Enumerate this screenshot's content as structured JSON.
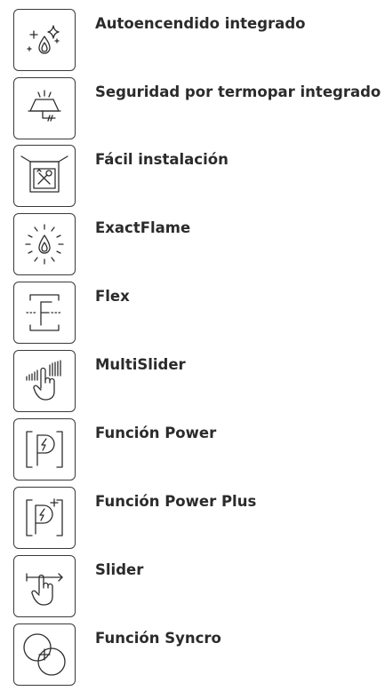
{
  "features": [
    {
      "label": "Autoencendido integrado",
      "icon": "auto-ignition-sparkle-flame-icon"
    },
    {
      "label": "Seguridad por termopar integrado",
      "icon": "thermocouple-safety-icon"
    },
    {
      "label": "Fácil instalación",
      "icon": "easy-installation-tools-icon"
    },
    {
      "label": "ExactFlame",
      "icon": "exact-flame-icon"
    },
    {
      "label": "Flex",
      "icon": "flex-zone-icon"
    },
    {
      "label": "MultiSlider",
      "icon": "multislider-hand-icon"
    },
    {
      "label": "Función Power",
      "icon": "power-function-icon"
    },
    {
      "label": "Función Power Plus",
      "icon": "power-plus-function-icon"
    },
    {
      "label": "Slider",
      "icon": "slider-hand-arrow-icon"
    },
    {
      "label": "Función Syncro",
      "icon": "syncro-circles-icon"
    }
  ]
}
